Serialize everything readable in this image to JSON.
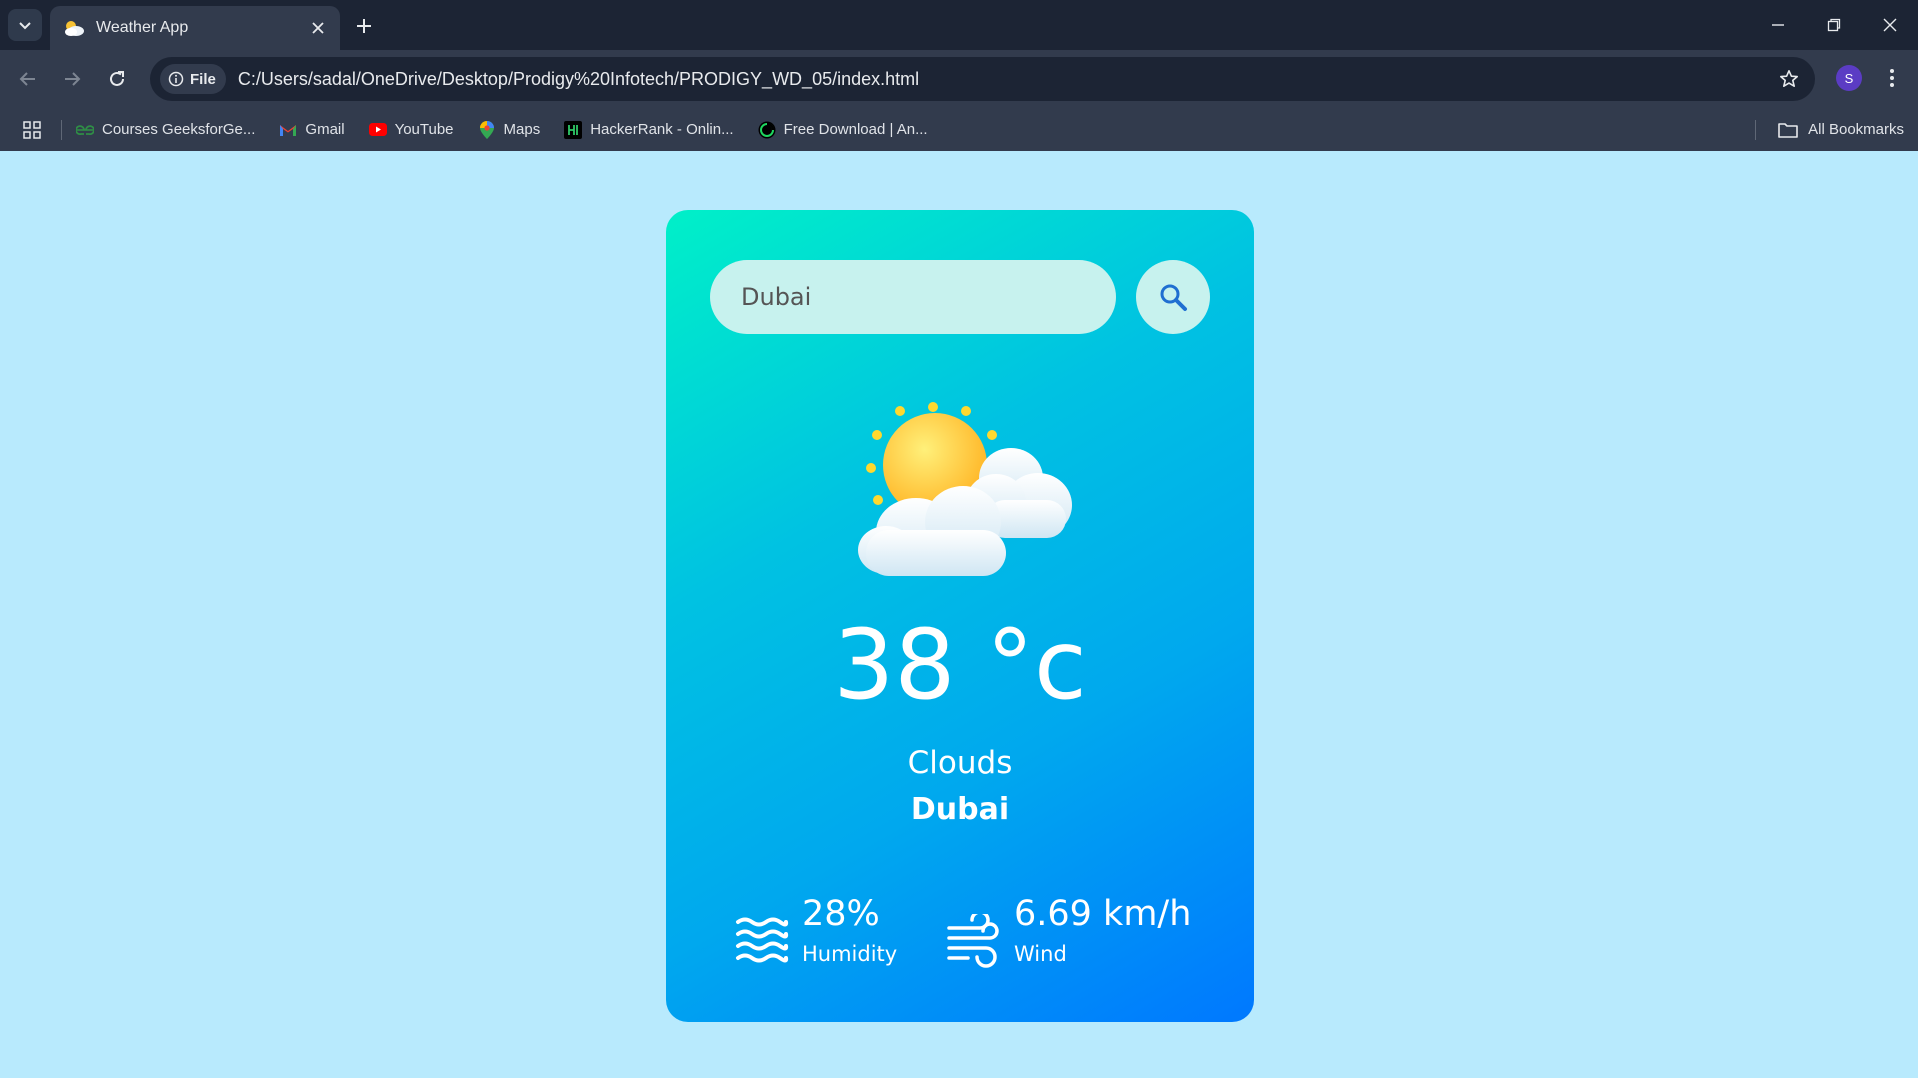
{
  "browser": {
    "tab": {
      "title": "Weather App"
    },
    "address": {
      "site_chip": "File",
      "url": "C:/Users/sadal/OneDrive/Desktop/Prodigy%20Infotech/PRODIGY_WD_05/index.html"
    },
    "profile_initial": "S",
    "bookmarks": [
      {
        "label": "Courses GeeksforGe...",
        "icon": "geeksforgeeks-icon"
      },
      {
        "label": "Gmail",
        "icon": "gmail-icon"
      },
      {
        "label": "YouTube",
        "icon": "youtube-icon"
      },
      {
        "label": "Maps",
        "icon": "maps-icon"
      },
      {
        "label": "HackerRank - Onlin...",
        "icon": "hackerrank-icon"
      },
      {
        "label": "Free Download | An...",
        "icon": "download-site-icon"
      }
    ],
    "all_bookmarks_label": "All Bookmarks"
  },
  "weather": {
    "search": {
      "value": "Dubai"
    },
    "temperature": "38 °c",
    "condition": "Clouds",
    "city": "Dubai",
    "humidity": {
      "value": "28%",
      "label": "Humidity"
    },
    "wind": {
      "value": "6.69 km/h",
      "label": "Wind"
    },
    "icon": "sun-behind-clouds-icon"
  },
  "colors": {
    "page_background": "#b8eafd",
    "card_gradient_start": "#00f0c8",
    "card_gradient_end": "#0078ff",
    "search_background": "#c7f2ee",
    "chrome_dark": "#1c2434",
    "chrome_mid": "#323b4d"
  }
}
